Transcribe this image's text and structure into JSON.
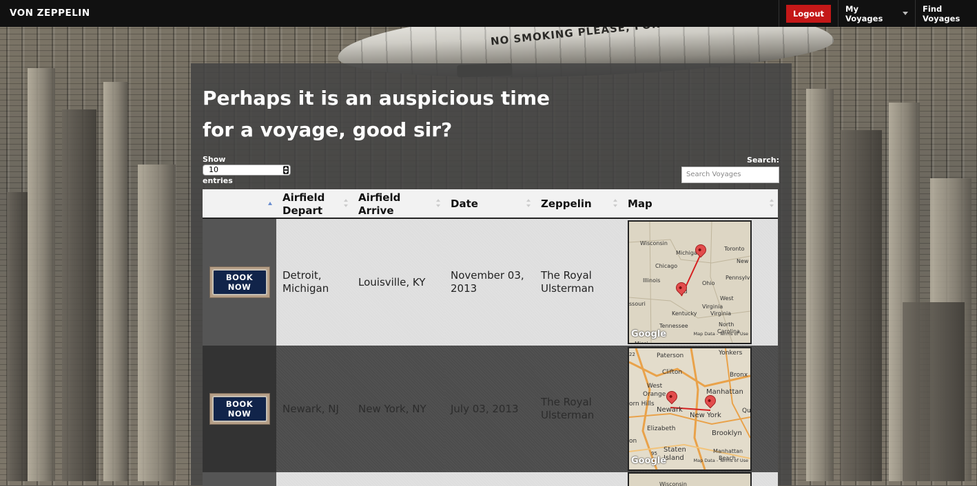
{
  "topbar": {
    "brand": "VON ZEPPELIN",
    "logout": "Logout",
    "my_voyages": "My Voyages",
    "find_voyages": "Find Voyages"
  },
  "background": {
    "zeppelin_text": "NO SMOKING PLEASE, FOR"
  },
  "page": {
    "headline": "Perhaps it is an auspicious time for a voyage, good sir?"
  },
  "controls": {
    "show_label": "Show",
    "entries_value": "10",
    "entries_label": "entries",
    "search_label": "Search:",
    "search_placeholder": "Search Voyages"
  },
  "table": {
    "columns": [
      "",
      "Airfield Depart",
      "Airfield Arrive",
      "Date",
      "Zeppelin",
      "Map"
    ],
    "rows": [
      {
        "action": "BOOK NOW",
        "depart": "Detroit, Michigan",
        "arrive": "Louisville, KY",
        "date": "November 03, 2013",
        "zeppelin": "The Royal Ulsterman",
        "map": {
          "labels": [
            "Wisconsin",
            "Michigan",
            "Toronto",
            "Chicago",
            "New",
            "Illinois",
            "Ohio",
            "Pennsylvar",
            "Ind",
            "West",
            "Virginia",
            "ssouri",
            "Kentucky",
            "Virginia",
            "Tennessee",
            "North",
            "Carolina",
            "Missi"
          ],
          "google": "Google",
          "map_data": "Map Data",
          "terms": "Terms of Use"
        }
      },
      {
        "action": "BOOK NOW",
        "depart": "Newark, NJ",
        "arrive": "New York, NY",
        "date": "July 03, 2013",
        "zeppelin": "The Royal Ulsterman",
        "map": {
          "labels": [
            "Paterson",
            "Yonkers",
            "Clifton",
            "Bronx",
            "West",
            "Orange",
            "Manhattan",
            "orn Hills",
            "Newark",
            "New York",
            "Qu",
            "Elizabeth",
            "Brooklyn",
            "on",
            "Staten",
            "Island",
            "Manhattan",
            "Beach",
            "22",
            "95"
          ],
          "google": "Google",
          "map_data": "Map Data",
          "terms": "Terms of Use"
        }
      },
      {
        "map": {
          "labels": [
            "Wisconsin"
          ]
        }
      }
    ]
  }
}
